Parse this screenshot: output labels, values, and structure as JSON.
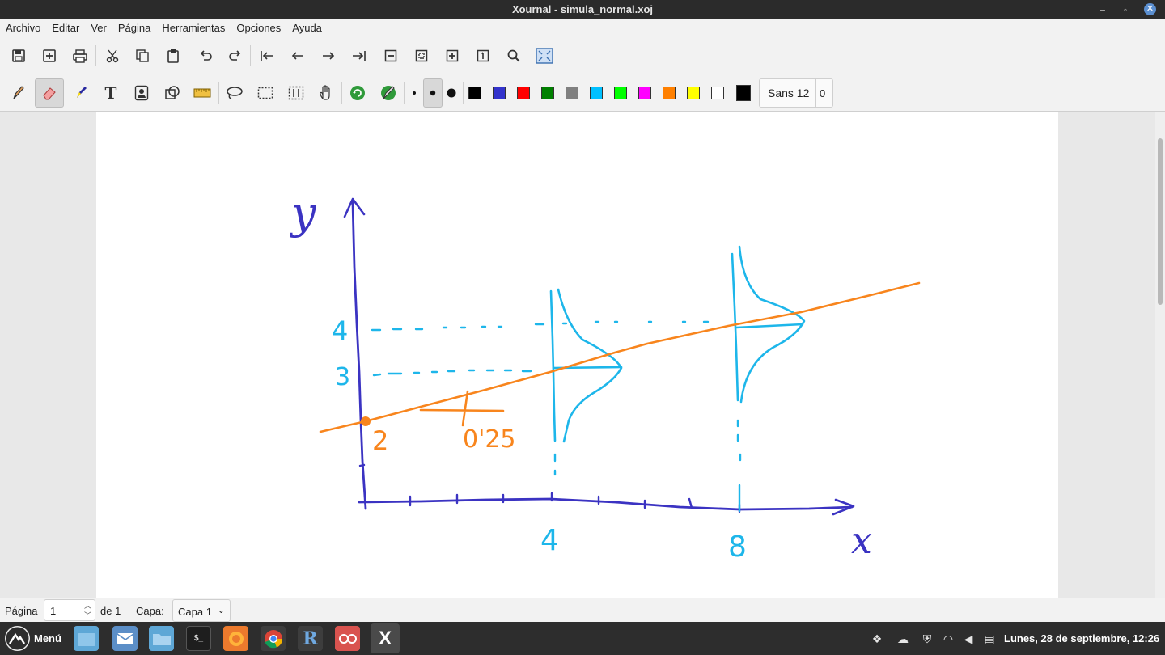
{
  "window": {
    "title": "Xournal - simula_normal.xoj",
    "minimize": "–",
    "restore": "◦",
    "close": "✕"
  },
  "menu": [
    "Archivo",
    "Editar",
    "Ver",
    "Página",
    "Herramientas",
    "Opciones",
    "Ayuda"
  ],
  "toolbar1": [
    "save-icon",
    "new-page-icon",
    "print-icon",
    "cut-icon",
    "copy-icon",
    "paste-icon",
    "undo-icon",
    "redo-icon",
    "first-page-icon",
    "previous-page-icon",
    "next-page-icon",
    "last-page-icon",
    "zoom-out-icon",
    "zoom-fit-icon",
    "zoom-in-icon",
    "zoom-100-icon",
    "zoom-search-icon",
    "fullscreen-icon"
  ],
  "toolbar2": {
    "tools": [
      "pen-icon",
      "eraser-icon",
      "highlighter-icon",
      "text-icon",
      "image-icon",
      "shape-recognizer-icon",
      "ruler-icon",
      "lasso-select-icon",
      "rect-select-icon",
      "vertical-space-icon",
      "hand-icon",
      "default-tool-icon",
      "default-pen-icon"
    ],
    "colors": [
      "#000000",
      "#3333cc",
      "#ff0000",
      "#008000",
      "#808080",
      "#00c0ff",
      "#00ff00",
      "#ff00ff",
      "#ff8000",
      "#ffff00",
      "#ffffff"
    ],
    "font_label": "Sans 12",
    "font_size": "0"
  },
  "sketch": {
    "y_label": "y",
    "x_label": "x",
    "y_ticks": [
      "4",
      "3",
      "2"
    ],
    "slope_label": "0'25",
    "x_ticks": [
      "4",
      "8"
    ]
  },
  "status": {
    "page_label": "Página",
    "page_value": "1",
    "of_label": "de 1",
    "layer_label": "Capa:",
    "layer_value": "Capa 1"
  },
  "taskbar": {
    "menu_label": "Menú",
    "clock": "Lunes, 28 de septiembre, 12:26"
  }
}
